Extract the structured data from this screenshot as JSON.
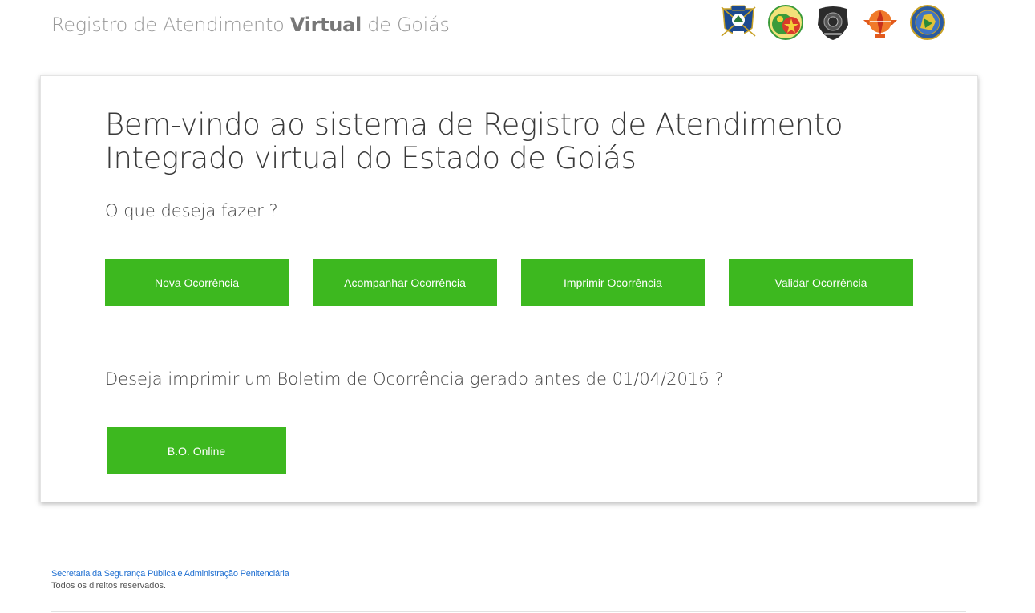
{
  "header": {
    "title_prefix": "Registro de Atendimento ",
    "title_strong": "Virtual",
    "title_suffix": " de Goiás",
    "logos": [
      {
        "icon": "police-crest-icon",
        "color": "#1d4a8f"
      },
      {
        "icon": "fire-department-crest-icon",
        "color": "#3a9b3a"
      },
      {
        "icon": "civil-police-badge-icon",
        "color": "#2b2b2b"
      },
      {
        "icon": "scientific-police-crest-icon",
        "color": "#e25a1c"
      },
      {
        "icon": "state-security-crest-icon",
        "color": "#2a5aa0"
      }
    ]
  },
  "main": {
    "welcome": "Bem-vindo ao sistema de Registro de Atendimento Integrado virtual do Estado de Goiás",
    "question": "O que deseja fazer ?",
    "actions": [
      {
        "label": "Nova Ocorrência"
      },
      {
        "label": "Acompanhar Ocorrência"
      },
      {
        "label": "Imprimir Ocorrência"
      },
      {
        "label": "Validar Ocorrência"
      }
    ],
    "legacy_question": "Deseja imprimir um Boletim de Ocorrência gerado antes de 01/04/2016 ?",
    "legacy_button": "B.O. Online"
  },
  "footer": {
    "org_link": "Secretaria da Segurança Pública e Administração Penitenciária",
    "rights": "Todos os direitos reservados."
  },
  "colors": {
    "accent_green": "#3db81f",
    "link_blue": "#1f6fd1"
  }
}
